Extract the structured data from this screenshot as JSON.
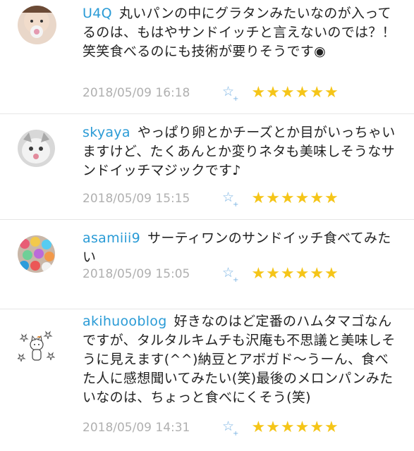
{
  "comments": [
    {
      "user": "U4Q",
      "text": "丸いパンの中にグラタンみたいなのが入ってるのは、もはやサンドイッチと言えないのでは？！笑笑食べるのにも技術が要りそうです◉",
      "date": "2018/05/09 16:18",
      "stars": "★★★★★★",
      "add_star": "☆",
      "add_plus": "+"
    },
    {
      "user": "skyaya",
      "text": "やっぱり卵とかチーズとか目がいっちゃいますけど、たくあんとか変りネタも美味しそうなサンドイッチマジックです♪",
      "date": "2018/05/09 15:15",
      "stars": "★★★★★★",
      "add_star": "☆",
      "add_plus": "+"
    },
    {
      "user": "asamiii9",
      "text": "サーティワンのサンドイッチ食べてみたい",
      "date": "2018/05/09 15:05",
      "stars": "★★★★★★",
      "add_star": "☆",
      "add_plus": "+"
    },
    {
      "user": "akihuooblog",
      "text": "好きなのはど定番のハムタマゴなんですが、タルタルキムチも沢庵も不思議と美味しそうに見えます(^^)納豆とアボガド〜うーん、食べた人に感想聞いてみたい(笑)最後のメロンパンみたいなのは、ちょっと食べにくそう(笑)",
      "date": "2018/05/09 14:31",
      "stars": "★★★★★★",
      "add_star": "☆",
      "add_plus": "+"
    }
  ],
  "colors": {
    "username": "#2a9bd6",
    "meta": "#b0b0b0",
    "star": "#f5c518",
    "add_star": "#7ab3e3"
  }
}
